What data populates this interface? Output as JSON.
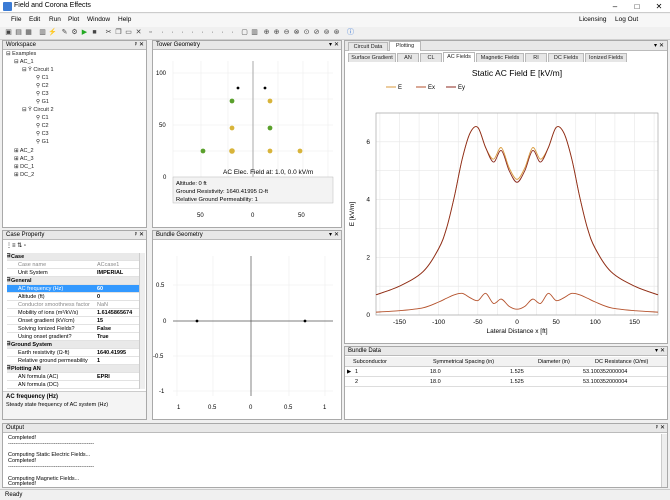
{
  "window": {
    "title": "Field and Corona Effects",
    "min": "–",
    "max": "□",
    "close": "✕"
  },
  "menu": [
    "File",
    "Edit",
    "Run",
    "Plot",
    "Window",
    "Help"
  ],
  "menu_right": [
    "Licensing",
    "Log Out"
  ],
  "workspace": {
    "title": "Workspace",
    "root": "Examples",
    "ac1": "AC_1",
    "circuit1": "Circuit 1",
    "circuit2": "Circuit 2",
    "c1": "C1",
    "c2": "C2",
    "c3": "C3",
    "g1": "G1",
    "ac2": "AC_2",
    "ac3": "AC_3",
    "dc1": "DC_1",
    "dc2": "DC_2"
  },
  "case_property": {
    "title": "Case Property",
    "rows": [
      {
        "t": "cat",
        "k": "Case"
      },
      {
        "t": "gray",
        "k": "Case name",
        "v": "ACcase1"
      },
      {
        "t": "norm",
        "k": "Unit System",
        "v": "IMPERIAL"
      },
      {
        "t": "cat",
        "k": "General"
      },
      {
        "t": "sel",
        "k": "AC frequency (Hz)",
        "v": "60"
      },
      {
        "t": "norm",
        "k": "Altitude (ft)",
        "v": "0"
      },
      {
        "t": "gray",
        "k": "Conductor smoothness factor",
        "v": "NaN"
      },
      {
        "t": "norm",
        "k": "Mobility of ions (m²/kV/s)",
        "v": "1.6145865674"
      },
      {
        "t": "norm",
        "k": "Onset gradient (kV/cm)",
        "v": "15"
      },
      {
        "t": "norm",
        "k": "Solving Ionized Fields?",
        "v": "False"
      },
      {
        "t": "norm",
        "k": "Using onset gradient?",
        "v": "True"
      },
      {
        "t": "cat",
        "k": "Ground System"
      },
      {
        "t": "norm",
        "k": "Earth resistivity (Ω-ft)",
        "v": "1640.41995"
      },
      {
        "t": "norm",
        "k": "Relative ground permeability",
        "v": "1"
      },
      {
        "t": "cat",
        "k": "Plotting AN"
      },
      {
        "t": "norm",
        "k": "AN formula (AC)",
        "v": "EPRI"
      },
      {
        "t": "norm",
        "k": "AN formula (DC)",
        "v": ""
      }
    ],
    "desc_title": "AC frequency (Hz)",
    "desc_text": "Steady state frequency of AC system (Hz)"
  },
  "tower": {
    "title": "Tower Geometry",
    "annot": "AC Elec. Field at: 1.0, 0.0 kV/m",
    "info1": "Altitude: 0 ft",
    "info2": "Ground Resistivity: 1640.41995 Ω-ft",
    "info3": "Relative Ground Permeability: 1",
    "yticks": [
      "100",
      "50",
      "0"
    ],
    "xticks": [
      "50",
      "0",
      "50"
    ]
  },
  "bundle_geom": {
    "title": "Bundle Geometry",
    "yticks": [
      "0.5",
      "0",
      "-0.5",
      "-1"
    ],
    "xticks": [
      "1",
      "0.5",
      "0",
      "0.5",
      "1"
    ]
  },
  "plot": {
    "top_tabs": [
      "Circuit Data",
      "Plotting"
    ],
    "sub_tabs": [
      "Surface Gradient",
      "AN",
      "CL",
      "AC Fields",
      "Magnetic Fields",
      "RI",
      "DC Fields",
      "Ionized Fields"
    ]
  },
  "chart_data": {
    "type": "line",
    "title": "Static AC Field E [kV/m]",
    "xlabel": "Lateral Distance x [ft]",
    "ylabel": "E [kV/m]",
    "xlim": [
      -180,
      180
    ],
    "ylim": [
      0,
      7
    ],
    "x": [
      -180,
      -150,
      -120,
      -100,
      -90,
      -80,
      -70,
      -60,
      -50,
      -40,
      -30,
      -20,
      -10,
      0,
      10,
      20,
      30,
      40,
      50,
      60,
      70,
      80,
      90,
      100,
      120,
      150,
      180
    ],
    "series": [
      {
        "name": "E",
        "color": "#d89a3c",
        "values": [
          0.7,
          1.0,
          1.5,
          2.3,
          3.0,
          4.1,
          5.4,
          6.3,
          6.5,
          5.8,
          5.4,
          5.8,
          5.1,
          4.7,
          5.1,
          5.8,
          5.4,
          5.8,
          6.5,
          6.3,
          5.4,
          4.1,
          3.0,
          2.3,
          1.5,
          1.0,
          0.7
        ]
      },
      {
        "name": "Ex",
        "color": "#b5522c",
        "values": [
          0.1,
          0.15,
          0.25,
          0.45,
          0.58,
          0.7,
          0.75,
          0.6,
          0.5,
          0.75,
          0.4,
          0.55,
          0.3,
          0.2,
          0.3,
          0.55,
          0.4,
          0.75,
          0.5,
          0.6,
          0.75,
          0.7,
          0.58,
          0.45,
          0.25,
          0.15,
          0.1
        ]
      },
      {
        "name": "Ey",
        "color": "#8c2a1f",
        "values": [
          0.7,
          1.0,
          1.5,
          2.3,
          3.0,
          4.1,
          5.4,
          6.3,
          6.5,
          5.8,
          5.3,
          5.7,
          5.0,
          4.6,
          5.0,
          5.7,
          5.3,
          5.8,
          6.5,
          6.3,
          5.4,
          4.1,
          3.0,
          2.3,
          1.5,
          1.0,
          0.7
        ]
      }
    ],
    "xticks": [
      "-150",
      "-100",
      "-50",
      "0",
      "50",
      "100",
      "150"
    ],
    "yticks": [
      "0",
      "2",
      "4",
      "6"
    ]
  },
  "bundle_data": {
    "title": "Bundle Data",
    "headers": [
      "Subconductor",
      "Symmetrical Spacing (in)",
      "Diameter (in)",
      "DC Resistance (Ω/mi)"
    ],
    "rows": [
      [
        "1",
        "18.0",
        "1.525",
        "53.100352000004"
      ],
      [
        "2",
        "18.0",
        "1.525",
        "53.100352000004"
      ]
    ]
  },
  "output": {
    "title": "Output",
    "lines": [
      "Completed!",
      "-----------------------------------------------",
      "",
      "Computing Static Electric Fields...",
      "Completed!",
      "-----------------------------------------------",
      "",
      "Computing Magnetic Fields...",
      "Completed!"
    ]
  },
  "status": "Ready"
}
